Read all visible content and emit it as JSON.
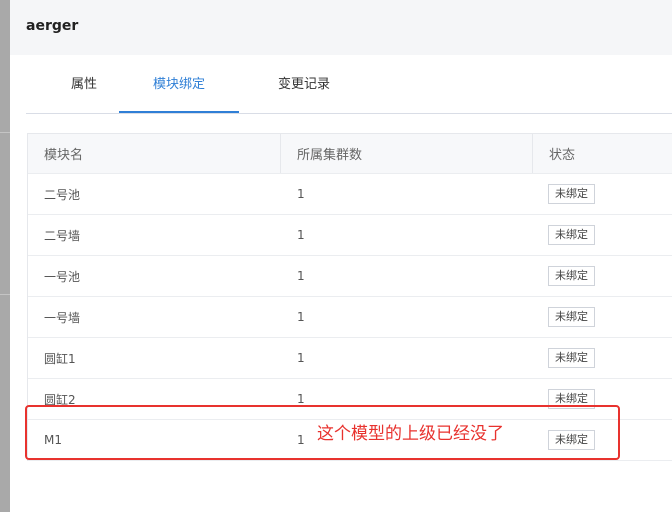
{
  "header": {
    "title": "aerger"
  },
  "tabs": [
    {
      "label": "属性",
      "active": false
    },
    {
      "label": "模块绑定",
      "active": true
    },
    {
      "label": "变更记录",
      "active": false
    }
  ],
  "table": {
    "columns": [
      "模块名",
      "所属集群数",
      "状态"
    ],
    "rows": [
      {
        "name": "二号池",
        "clusters": "1",
        "status": "未绑定"
      },
      {
        "name": "二号墙",
        "clusters": "1",
        "status": "未绑定"
      },
      {
        "name": "一号池",
        "clusters": "1",
        "status": "未绑定"
      },
      {
        "name": "一号墙",
        "clusters": "1",
        "status": "未绑定"
      },
      {
        "name": "圆缸1",
        "clusters": "1",
        "status": "未绑定"
      },
      {
        "name": "圆缸2",
        "clusters": "1",
        "status": "未绑定"
      },
      {
        "name": "M1",
        "clusters": "1",
        "status": "未绑定"
      }
    ]
  },
  "annotation": {
    "text": "这个模型的上级已经没了",
    "color": "#e8322e"
  },
  "colors": {
    "accent": "#2f7fd6",
    "header_bg": "#f5f6f8",
    "backdrop": "#a9a9a9"
  }
}
